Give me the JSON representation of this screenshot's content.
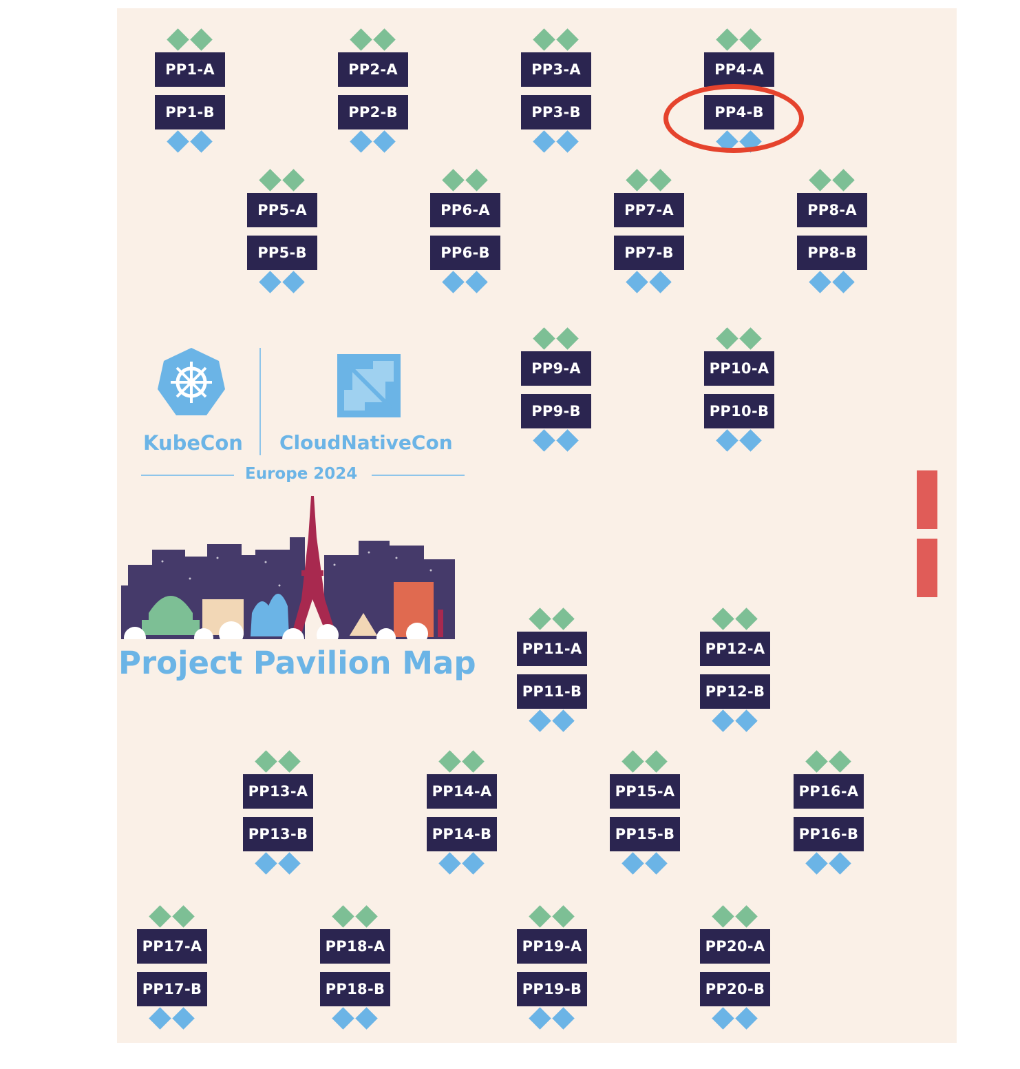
{
  "map": {
    "branding": {
      "kubecon": "KubeCon",
      "cloudnativecon": "CloudNativeCon",
      "event": "Europe 2024",
      "title": "Project Pavilion Map"
    },
    "highlighted_booth": "PP4-B",
    "colors": {
      "background": "#faf0e7",
      "booth": "#2b2550",
      "top_marker": "#7dbf95",
      "bottom_marker": "#6bb4e6",
      "highlight": "#e5432d",
      "side_marker": "#e05c58"
    },
    "booths": [
      {
        "id": "pp1",
        "a": "PP1-A",
        "b": "PP1-B"
      },
      {
        "id": "pp2",
        "a": "PP2-A",
        "b": "PP2-B"
      },
      {
        "id": "pp3",
        "a": "PP3-A",
        "b": "PP3-B"
      },
      {
        "id": "pp4",
        "a": "PP4-A",
        "b": "PP4-B"
      },
      {
        "id": "pp5",
        "a": "PP5-A",
        "b": "PP5-B"
      },
      {
        "id": "pp6",
        "a": "PP6-A",
        "b": "PP6-B"
      },
      {
        "id": "pp7",
        "a": "PP7-A",
        "b": "PP7-B"
      },
      {
        "id": "pp8",
        "a": "PP8-A",
        "b": "PP8-B"
      },
      {
        "id": "pp9",
        "a": "PP9-A",
        "b": "PP9-B"
      },
      {
        "id": "pp10",
        "a": "PP10-A",
        "b": "PP10-B"
      },
      {
        "id": "pp11",
        "a": "PP11-A",
        "b": "PP11-B"
      },
      {
        "id": "pp12",
        "a": "PP12-A",
        "b": "PP12-B"
      },
      {
        "id": "pp13",
        "a": "PP13-A",
        "b": "PP13-B"
      },
      {
        "id": "pp14",
        "a": "PP14-A",
        "b": "PP14-B"
      },
      {
        "id": "pp15",
        "a": "PP15-A",
        "b": "PP15-B"
      },
      {
        "id": "pp16",
        "a": "PP16-A",
        "b": "PP16-B"
      },
      {
        "id": "pp17",
        "a": "PP17-A",
        "b": "PP17-B"
      },
      {
        "id": "pp18",
        "a": "PP18-A",
        "b": "PP18-B"
      },
      {
        "id": "pp19",
        "a": "PP19-A",
        "b": "PP19-B"
      },
      {
        "id": "pp20",
        "a": "PP20-A",
        "b": "PP20-B"
      }
    ]
  }
}
